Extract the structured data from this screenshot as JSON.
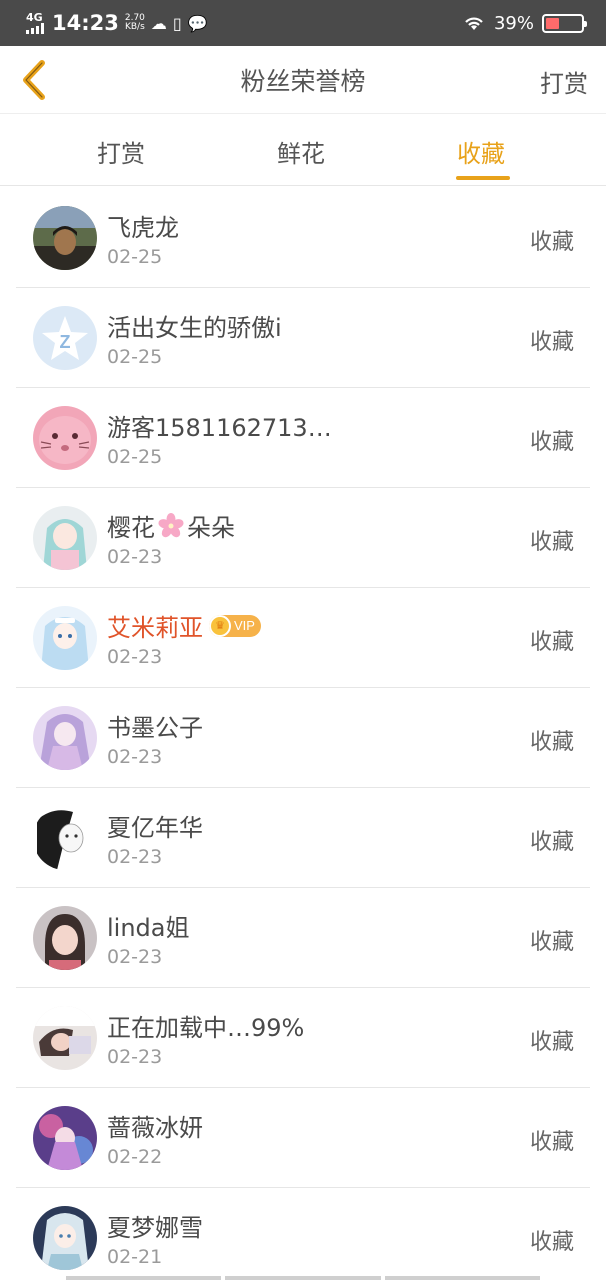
{
  "status_bar": {
    "network": "4G",
    "time": "14:23",
    "speed_value": "2.70",
    "speed_unit": "KB/s",
    "battery": "39%",
    "battery_level": 0.39
  },
  "nav": {
    "title": "粉丝荣誉榜",
    "action": "打赏"
  },
  "tabs": [
    {
      "label": "打赏",
      "active": false
    },
    {
      "label": "鲜花",
      "active": false
    },
    {
      "label": "收藏",
      "active": true
    }
  ],
  "accent_color": "#e8a21a",
  "vip_name_color": "#e0542a",
  "list": [
    {
      "name": "飞虎龙",
      "date": "02-25",
      "action": "收藏"
    },
    {
      "name": "活出女生的骄傲i",
      "date": "02-25",
      "action": "收藏"
    },
    {
      "name": "游客1581162713…",
      "date": "02-25",
      "action": "收藏"
    },
    {
      "name_pre": "樱花",
      "name_post": "朵朵",
      "date": "02-23",
      "action": "收藏"
    },
    {
      "name": "艾米莉亚",
      "vip": "VIP",
      "date": "02-23",
      "action": "收藏"
    },
    {
      "name": "书墨公子",
      "date": "02-23",
      "action": "收藏"
    },
    {
      "name": "夏亿年华",
      "date": "02-23",
      "action": "收藏"
    },
    {
      "name": "linda姐",
      "date": "02-23",
      "action": "收藏"
    },
    {
      "name": "正在加载中…99%",
      "date": "02-23",
      "action": "收藏"
    },
    {
      "name": "蔷薇冰妍",
      "date": "02-22",
      "action": "收藏"
    },
    {
      "name": "夏梦娜雪",
      "date": "02-21",
      "action": "收藏"
    }
  ]
}
